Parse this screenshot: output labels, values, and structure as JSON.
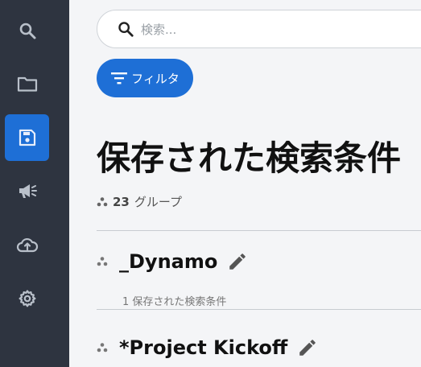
{
  "sidebar": {
    "items": [
      {
        "icon": "search-icon",
        "active": false
      },
      {
        "icon": "folder-icon",
        "active": false
      },
      {
        "icon": "save-icon",
        "active": true
      },
      {
        "icon": "megaphone-icon",
        "active": false
      },
      {
        "icon": "cloud-upload-icon",
        "active": false
      },
      {
        "icon": "gear-icon",
        "active": false
      }
    ],
    "colors": {
      "background": "#2e3440",
      "active": "#1e6fd6",
      "icon": "#b9c0ca"
    }
  },
  "search": {
    "placeholder": "検索..."
  },
  "filter": {
    "label": "フィルタ"
  },
  "page": {
    "title": "保存された検索条件",
    "group_count": "23",
    "group_unit": "グループ"
  },
  "groups": [
    {
      "name": "_Dynamo",
      "sub": "1 保存された検索条件"
    },
    {
      "name": "*Project Kickoff",
      "sub": ""
    }
  ],
  "colors": {
    "accent": "#1e6fd6",
    "background": "#f4f5f7"
  }
}
